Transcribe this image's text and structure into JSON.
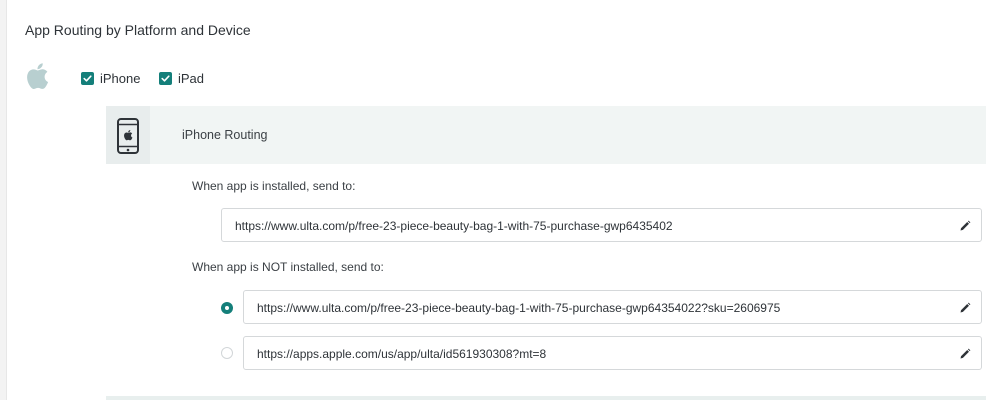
{
  "section": {
    "title": "App Routing by Platform and Device"
  },
  "platform": {
    "icon": "apple-icon",
    "devices": [
      {
        "label": "iPhone",
        "checked": true
      },
      {
        "label": "iPad",
        "checked": true
      }
    ]
  },
  "routing": {
    "device_icon": "smartphone-icon",
    "title": "iPhone Routing",
    "installed": {
      "label": "When app is installed, send to:",
      "url": "https://www.ulta.com/p/free-23-piece-beauty-bag-1-with-75-purchase-gwp6435402"
    },
    "not_installed": {
      "label": "When app is NOT installed, send to:",
      "options": [
        {
          "url": "https://www.ulta.com/p/free-23-piece-beauty-bag-1-with-75-purchase-gwp64354022?sku=2606975",
          "selected": true
        },
        {
          "url": "https://apps.apple.com/us/app/ulta/id561930308?mt=8",
          "selected": false
        }
      ]
    }
  },
  "colors": {
    "accent": "#147f7a",
    "header_bg": "#f1f5f4"
  }
}
